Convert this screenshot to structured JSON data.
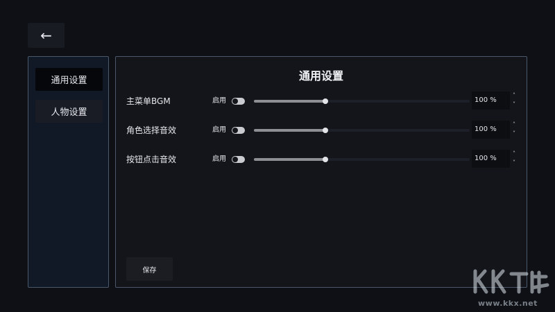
{
  "header": {
    "back_glyph": "←",
    "back_icon": "arrow-left-icon"
  },
  "sidebar": {
    "items": [
      {
        "label": "通用设置",
        "active": true
      },
      {
        "label": "人物设置",
        "active": false
      }
    ]
  },
  "panel": {
    "title": "通用设置",
    "rows": [
      {
        "label": "主菜单BGM",
        "enable_label": "启用",
        "enabled": true,
        "volume_fraction": 0.33,
        "value_text": "100 %"
      },
      {
        "label": "角色选择音效",
        "enable_label": "启用",
        "enabled": true,
        "volume_fraction": 0.33,
        "value_text": "100 %"
      },
      {
        "label": "按钮点击音效",
        "enable_label": "启用",
        "enabled": true,
        "volume_fraction": 0.33,
        "value_text": "100 %"
      }
    ],
    "spin_up_glyph": "˄",
    "spin_down_glyph": "˅",
    "save_label": "保存"
  },
  "watermark": {
    "url": "www.kkx.net"
  },
  "colors": {
    "background": "#0e1016",
    "panel_border": "#4b596c",
    "slider_fill": "#8d8f95",
    "toggle_on": "#c9cbd0"
  }
}
